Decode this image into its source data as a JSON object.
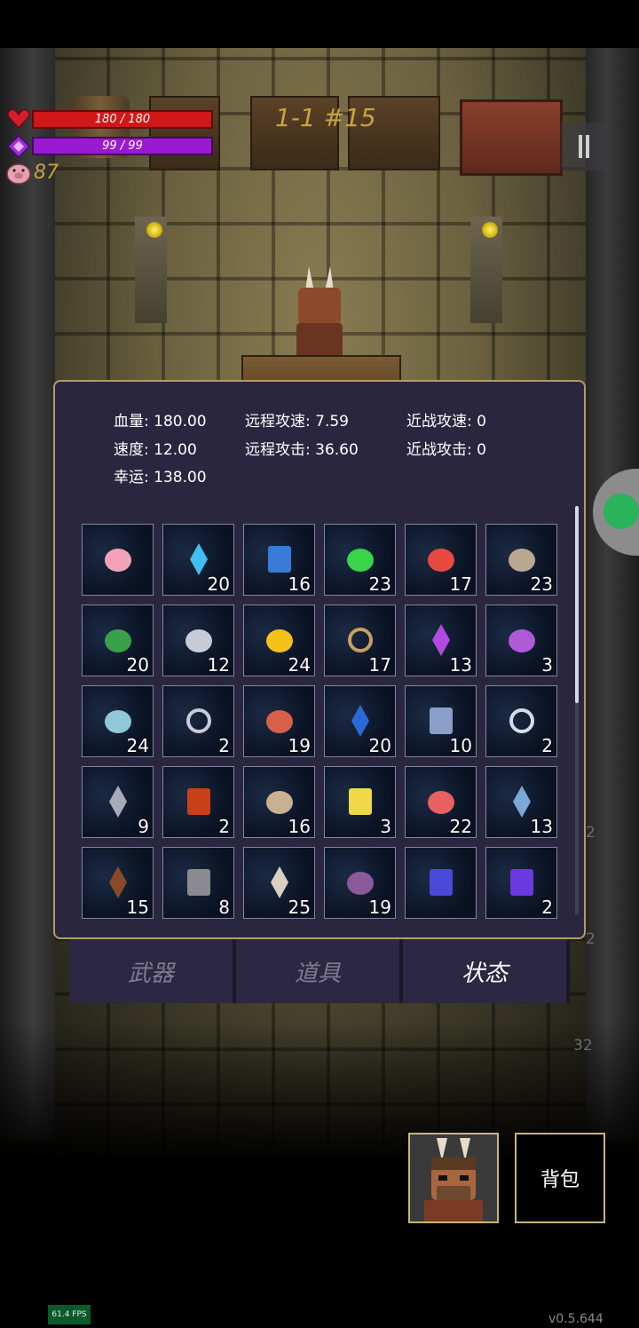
{
  "hud": {
    "hp_text": "180 / 180",
    "hp_fraction": 1.0,
    "mp_text": "99 / 99",
    "mp_fraction": 1.0,
    "coins": "87",
    "level": "1-1 #15"
  },
  "stats": {
    "hp_label": "血量:",
    "hp_value": "180.00",
    "ranged_speed_label": "远程攻速:",
    "ranged_speed_value": "7.59",
    "melee_speed_label": "近战攻速:",
    "melee_speed_value": "0",
    "speed_label": "速度:",
    "speed_value": "12.00",
    "ranged_attack_label": "远程攻击:",
    "ranged_attack_value": "36.60",
    "melee_attack_label": "近战攻击:",
    "melee_attack_value": "0",
    "luck_label": "幸运:",
    "luck_value": "138.00"
  },
  "inventory": [
    {
      "icon": "piggy-bank-icon",
      "count": ""
    },
    {
      "icon": "blue-crystal-icon",
      "count": "20"
    },
    {
      "icon": "blue-spellbook-icon",
      "count": "16"
    },
    {
      "icon": "green-potion-icon",
      "count": "23"
    },
    {
      "icon": "red-flower-icon",
      "count": "17"
    },
    {
      "icon": "boots-icon",
      "count": "23"
    },
    {
      "icon": "four-leaf-clover-icon",
      "count": "20"
    },
    {
      "icon": "silver-ore-icon",
      "count": "12"
    },
    {
      "icon": "gold-orb-icon",
      "count": "24"
    },
    {
      "icon": "horseshoe-icon",
      "count": "17"
    },
    {
      "icon": "purple-wand-icon",
      "count": "13"
    },
    {
      "icon": "purple-slime-icon",
      "count": "3"
    },
    {
      "icon": "ice-rock-icon",
      "count": "24"
    },
    {
      "icon": "silver-ring-icon",
      "count": "2"
    },
    {
      "icon": "feathered-skull-icon",
      "count": "19"
    },
    {
      "icon": "water-drop-icon",
      "count": "20"
    },
    {
      "icon": "health-card-icon",
      "count": "10"
    },
    {
      "icon": "healing-ring-icon",
      "count": "2"
    },
    {
      "icon": "hooded-figure-icon",
      "count": "9"
    },
    {
      "icon": "red-tome-icon",
      "count": "2"
    },
    {
      "icon": "egg-icon",
      "count": "16"
    },
    {
      "icon": "hourglass-card-icon",
      "count": "3"
    },
    {
      "icon": "apple-icon",
      "count": "22"
    },
    {
      "icon": "blue-hammer-icon",
      "count": "13"
    },
    {
      "icon": "thorn-crown-icon",
      "count": "15"
    },
    {
      "icon": "tombstone-icon",
      "count": "8"
    },
    {
      "icon": "horn-icon",
      "count": "25"
    },
    {
      "icon": "purple-boots-icon",
      "count": "19"
    },
    {
      "icon": "rune-book-icon",
      "count": ""
    },
    {
      "icon": "void-cube-icon",
      "count": "2"
    }
  ],
  "tabs": [
    {
      "label": "武器",
      "active": false
    },
    {
      "label": "道具",
      "active": false
    },
    {
      "label": "状态",
      "active": true
    }
  ],
  "bag_label": "背包",
  "fps": "61.4 FPS",
  "version": "v0.5.644",
  "colors": {
    "hp": "#d11818",
    "mp": "#9a1ad1",
    "gold": "#c9a23e",
    "panel_bg": "#2b2640",
    "panel_border": "#b79b60"
  }
}
